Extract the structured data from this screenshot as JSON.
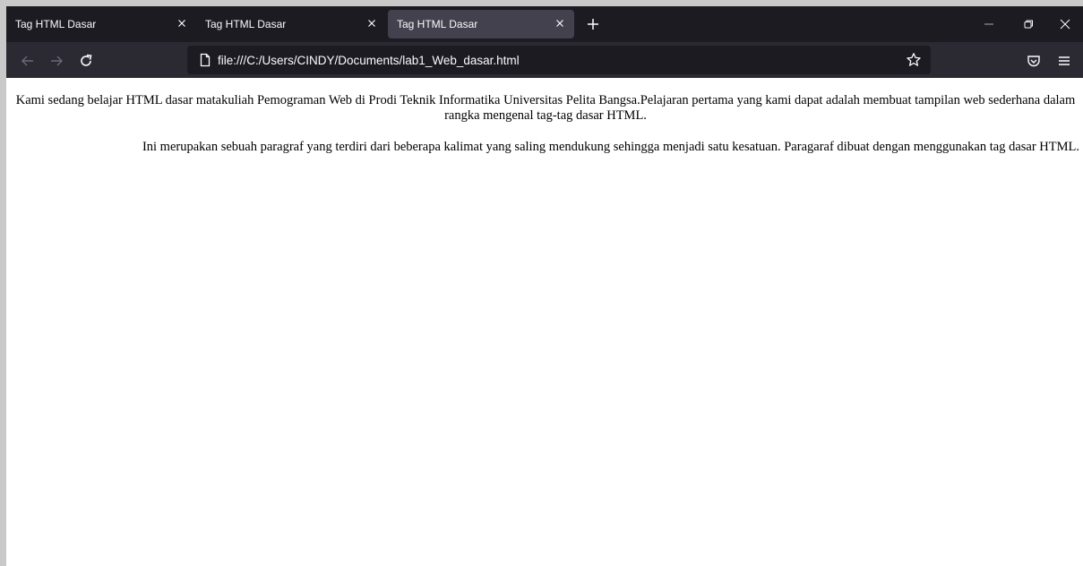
{
  "browser": {
    "tabs": [
      {
        "label": "Tag HTML Dasar",
        "active": false
      },
      {
        "label": "Tag HTML Dasar",
        "active": false
      },
      {
        "label": "Tag HTML Dasar",
        "active": true
      }
    ],
    "address": "file:///C:/Users/CINDY/Documents/lab1_Web_dasar.html",
    "icons": [
      "back-icon",
      "forward-icon",
      "reload-icon",
      "page-icon",
      "bookmark-star-icon",
      "pocket-icon",
      "menu-icon",
      "new-tab-icon",
      "minimize-icon",
      "restore-icon",
      "close-icon"
    ],
    "colors": {
      "tab_strip": "#1c1b22",
      "active_tab": "#42414d",
      "toolbar": "#2b2a33",
      "text": "#fbfbfe"
    }
  },
  "page": {
    "paragraph_1": "Kami sedang belajar HTML dasar matakuliah Pemograman Web di Prodi Teknik Informatika Universitas Pelita Bangsa.Pelajaran pertama yang kami dapat adalah membuat tampilan web sederhana dalam rangka mengenal tag-tag dasar HTML.",
    "paragraph_2": "Ini merupakan sebuah paragraf yang terdiri dari beberapa kalimat yang saling mendukung sehingga menjadi satu kesatuan. Paragaraf dibuat dengan menggunakan tag dasar HTML."
  }
}
